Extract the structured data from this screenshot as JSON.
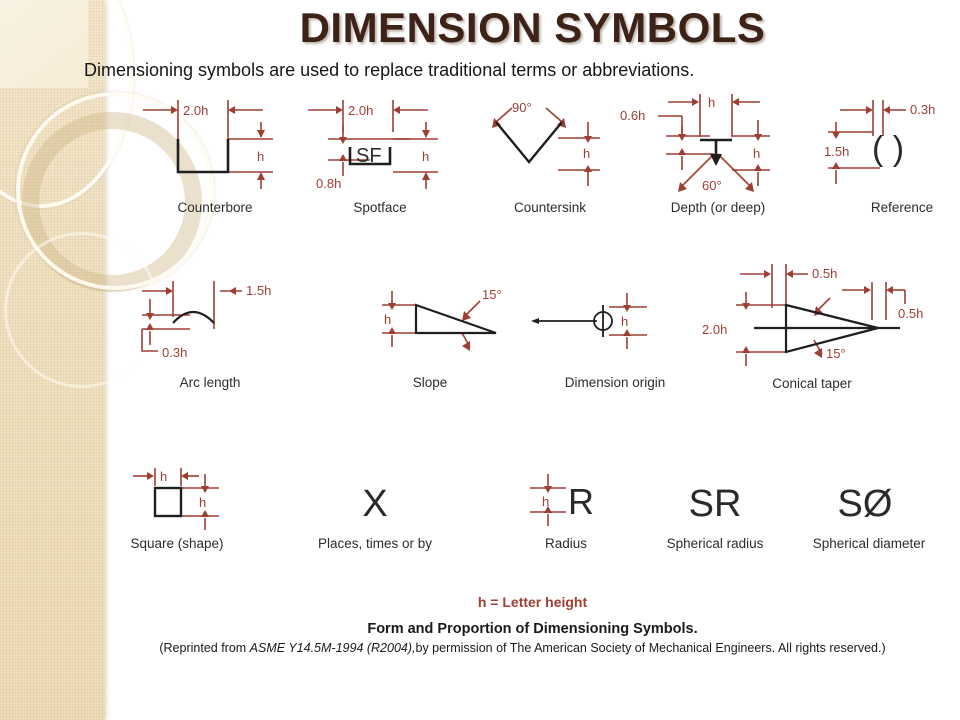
{
  "slide": {
    "title": "DIMENSION SYMBOLS",
    "subtitle": "Dimensioning symbols are used to replace traditional terms or abbreviations.",
    "accent_red": "#9e3f33",
    "title_color": "#3d2218",
    "band_color": "#f0e2c3",
    "background": "#ffffff"
  },
  "footer": {
    "h_note": "h = Letter height",
    "caption_title": "Form and Proportion of Dimensioning Symbols.",
    "caption_prefix": "(Reprinted from ",
    "caption_standard": "ASME Y14.5M-1994 (R2004),",
    "caption_suffix": "by  permission of The American Society of Mechanical Engineers. All rights reserved.)"
  },
  "symbols": {
    "row1": [
      {
        "name": "Counterbore",
        "glyph": "counterbore-bracket",
        "dims": [
          "2.0h",
          "h"
        ]
      },
      {
        "name": "Spotface",
        "glyph": "spotface-SF",
        "inner_text": "SF",
        "dims": [
          "2.0h",
          "h",
          "0.8h"
        ]
      },
      {
        "name": "Countersink",
        "glyph": "countersink-vee",
        "dims": [
          "90°",
          "h"
        ]
      },
      {
        "name": "Depth (or deep)",
        "glyph": "depth-arrow",
        "dims": [
          "h",
          "0.6h",
          "h",
          "60°"
        ]
      },
      {
        "name": "Reference",
        "glyph": "reference-parens",
        "inner_text": "( )",
        "dims": [
          "0.3h",
          "1.5h"
        ]
      }
    ],
    "row2": [
      {
        "name": "Arc length",
        "glyph": "arc-length-arc",
        "dims": [
          "1.5h",
          "0.3h"
        ]
      },
      {
        "name": "Slope",
        "glyph": "slope-triangle",
        "dims": [
          "h",
          "15°"
        ]
      },
      {
        "name": "Dimension origin",
        "glyph": "dimension-origin-circle",
        "dims": [
          "h"
        ]
      },
      {
        "name": "Conical taper",
        "glyph": "conical-taper-triangle",
        "dims": [
          "0.5h",
          "0.5h",
          "2.0h",
          "15°"
        ]
      }
    ],
    "row3": [
      {
        "name": "Square (shape)",
        "glyph": "square-outline",
        "dims": [
          "h",
          "h"
        ]
      },
      {
        "name": "Places, times or by",
        "glyph": "times-x",
        "inner_text": "X",
        "dims": []
      },
      {
        "name": "Radius",
        "glyph": "radius-R",
        "inner_text": "R",
        "dims": [
          "h"
        ]
      },
      {
        "name": "Spherical radius",
        "glyph": "spherical-radius-SR",
        "inner_text": "SR",
        "dims": []
      },
      {
        "name": "Spherical diameter",
        "glyph": "spherical-diameter-SD",
        "inner_text": "SØ",
        "dims": []
      }
    ]
  }
}
